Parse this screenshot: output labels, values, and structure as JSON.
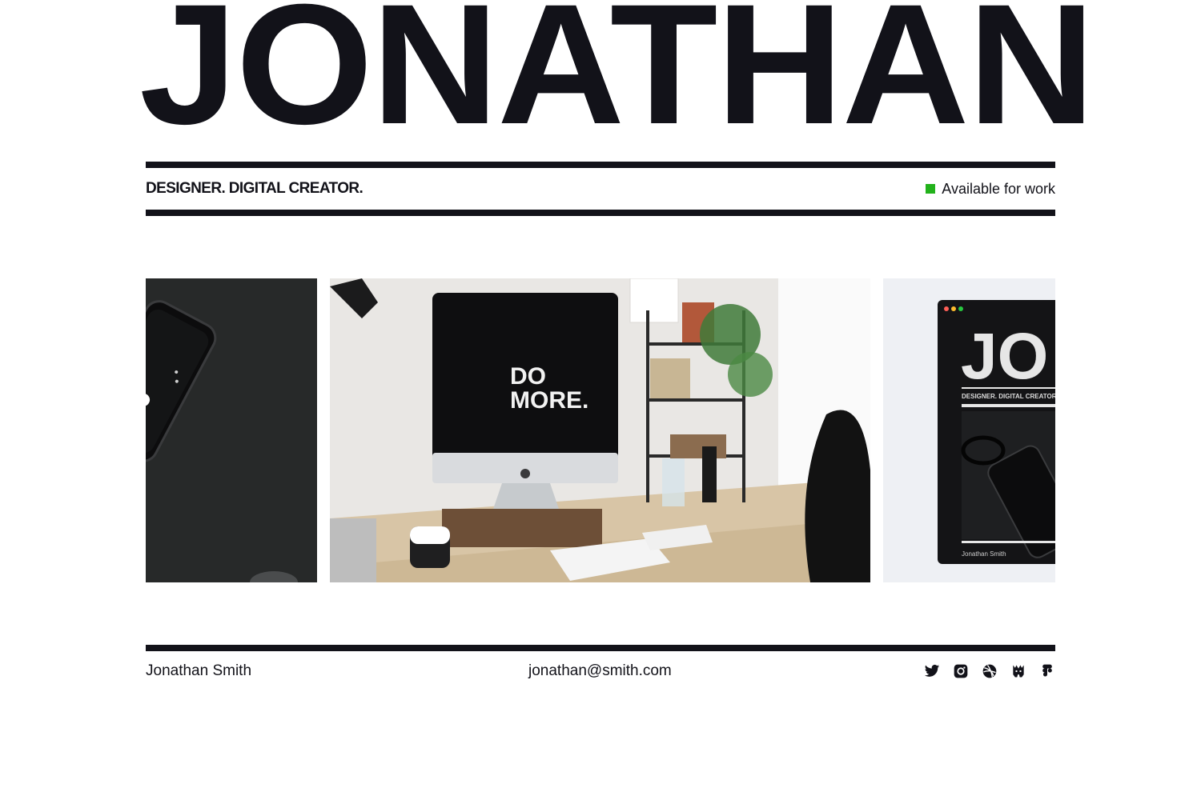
{
  "hero": {
    "name": "JONATHAN"
  },
  "header": {
    "tagline": "DESIGNER. DIGITAL CREATOR.",
    "availability": "Available for work",
    "status_color": "#22b21b"
  },
  "gallery": {
    "items": [
      {
        "name": "phone-on-black-desk-photo"
      },
      {
        "name": "imac-desk-setup-photo",
        "screen_text_line1": "DO",
        "screen_text_line2": "MORE."
      },
      {
        "name": "portfolio-site-preview",
        "preview_title": "JO",
        "preview_tagline": "DESIGNER. DIGITAL CREATOR.",
        "preview_footer": "Jonathan Smith"
      }
    ]
  },
  "footer": {
    "name": "Jonathan Smith",
    "email": "jonathan@smith.com",
    "socials": [
      "twitter-icon",
      "instagram-icon",
      "dribbble-icon",
      "producthunt-icon",
      "figma-icon"
    ]
  },
  "colors": {
    "ink": "#121219",
    "background": "#ffffff",
    "accent": "#22b21b"
  }
}
